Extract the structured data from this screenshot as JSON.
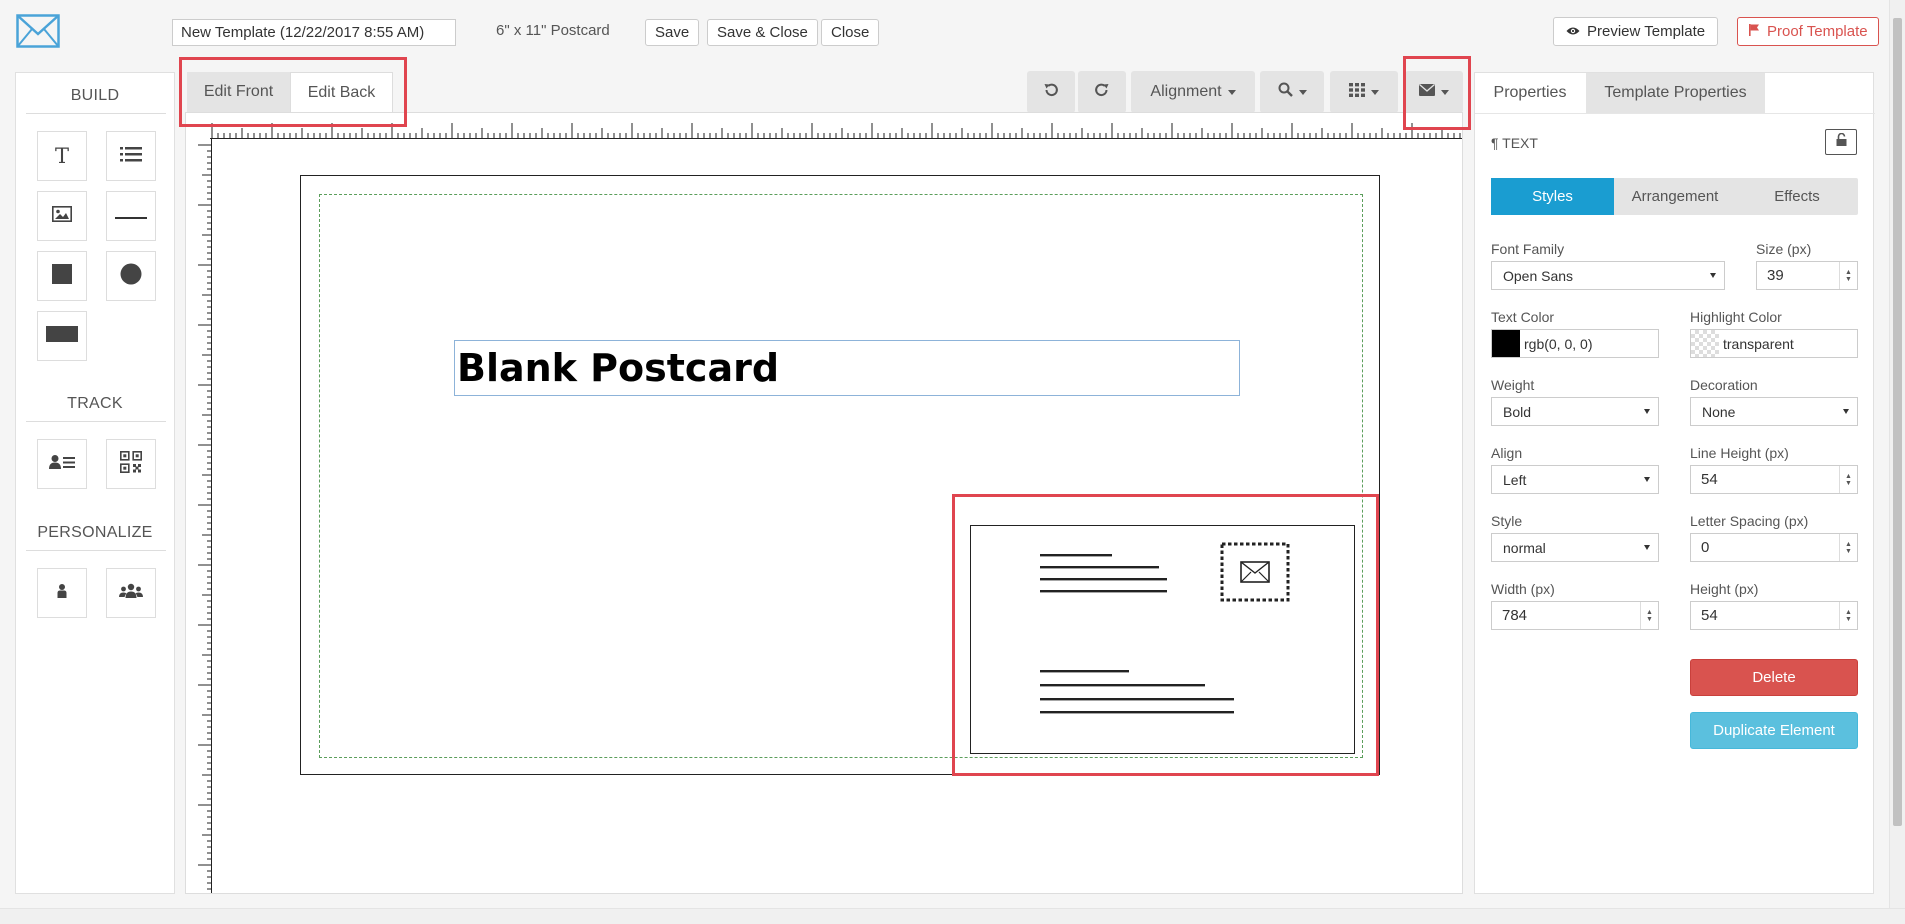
{
  "header": {
    "template_name": "New Template (12/22/2017 8:55 AM)",
    "size_label": "6\" x 11\" Postcard",
    "save_label": "Save",
    "save_close_label": "Save & Close",
    "close_label": "Close",
    "preview_label": "Preview Template",
    "proof_label": "Proof Template"
  },
  "build_panel": {
    "build_heading": "BUILD",
    "track_heading": "TRACK",
    "personalize_heading": "PERSONALIZE",
    "text_tool_glyph": "T"
  },
  "editor": {
    "tab_front": "Edit Front",
    "tab_back": "Edit Back",
    "alignment_label": "Alignment",
    "canvas_text": "Blank Postcard"
  },
  "properties": {
    "tab_properties": "Properties",
    "tab_template_properties": "Template Properties",
    "element_type": "¶ TEXT",
    "subtabs": {
      "styles": "Styles",
      "arrangement": "Arrangement",
      "effects": "Effects"
    },
    "font_family_label": "Font Family",
    "font_family_value": "Open Sans",
    "size_label": "Size (px)",
    "size_value": "39",
    "text_color_label": "Text Color",
    "text_color_value": "rgb(0, 0, 0)",
    "highlight_color_label": "Highlight Color",
    "highlight_color_value": "transparent",
    "weight_label": "Weight",
    "weight_value": "Bold",
    "decoration_label": "Decoration",
    "decoration_value": "None",
    "align_label": "Align",
    "align_value": "Left",
    "line_height_label": "Line Height (px)",
    "line_height_value": "54",
    "style_label": "Style",
    "style_value": "normal",
    "letter_spacing_label": "Letter Spacing (px)",
    "letter_spacing_value": "0",
    "width_label": "Width (px)",
    "width_value": "784",
    "height_label": "Height (px)",
    "height_value": "54",
    "delete_label": "Delete",
    "duplicate_label": "Duplicate Element"
  },
  "colors": {
    "accent_blue": "#1a9dd1",
    "delete_red": "#d9534f",
    "duplicate_cyan": "#5bc0de",
    "highlight_red": "#e0454f",
    "logo_blue": "#4aa3d8"
  }
}
